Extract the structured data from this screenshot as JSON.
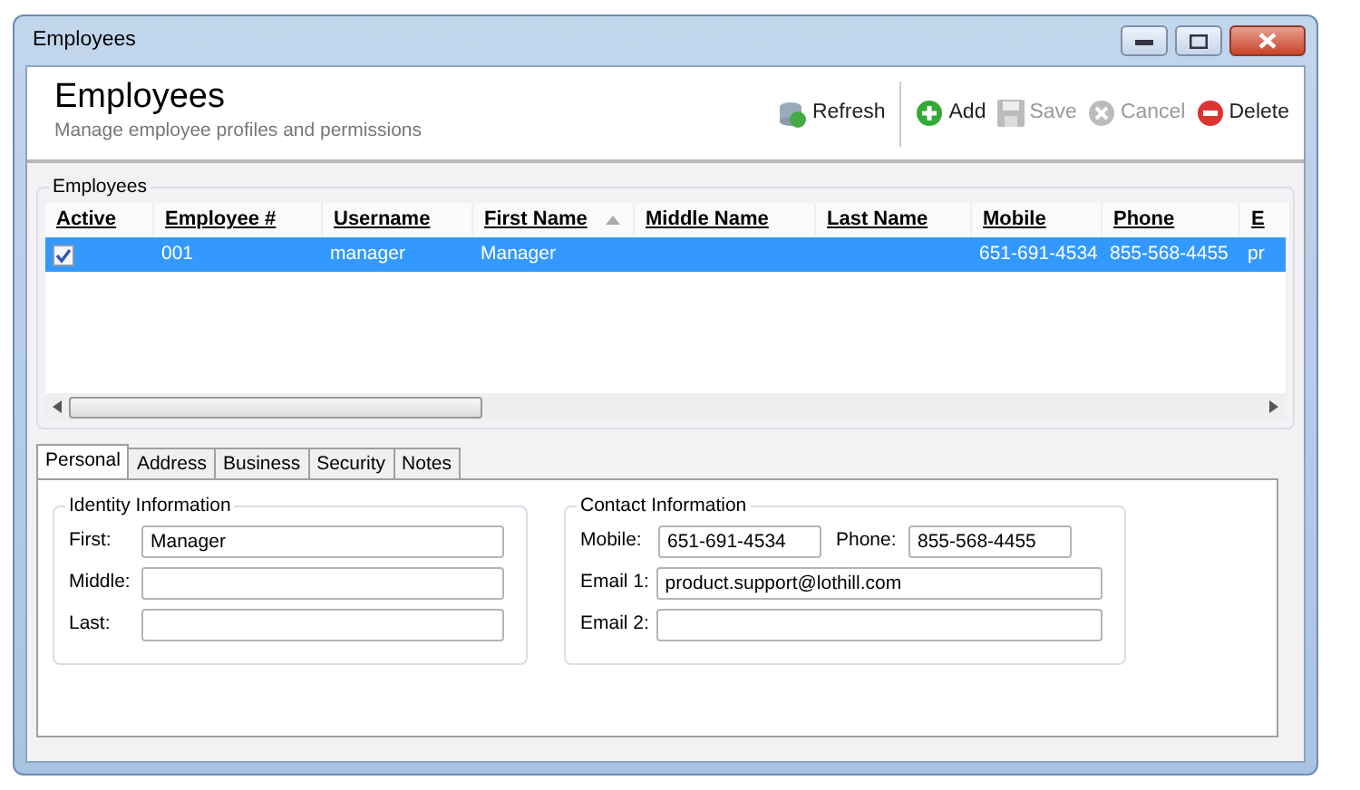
{
  "window": {
    "title": "Employees"
  },
  "header": {
    "title": "Employees",
    "subtitle": "Manage employee profiles and permissions"
  },
  "toolbar": [
    {
      "kind": "refresh",
      "label": "Refresh",
      "disabled": false
    },
    {
      "kind": "add",
      "label": "Add",
      "disabled": false
    },
    {
      "kind": "save",
      "label": "Save",
      "disabled": true
    },
    {
      "kind": "cancel",
      "label": "Cancel",
      "disabled": true
    },
    {
      "kind": "delete",
      "label": "Delete",
      "disabled": false
    }
  ],
  "grid": {
    "title": "Employees",
    "columns": [
      {
        "label": "Active",
        "sorted": false
      },
      {
        "label": "Employee #",
        "sorted": false
      },
      {
        "label": "Username",
        "sorted": false
      },
      {
        "label": "First Name",
        "sorted": true
      },
      {
        "label": "Middle Name",
        "sorted": false
      },
      {
        "label": "Last Name",
        "sorted": false
      },
      {
        "label": "Mobile",
        "sorted": false
      },
      {
        "label": "Phone",
        "sorted": false
      },
      {
        "label": "E",
        "sorted": false
      }
    ],
    "rows": [
      {
        "selected": true,
        "cells": [
          {
            "kind": "checkbox",
            "checked": true
          },
          {
            "kind": "text",
            "text": "001"
          },
          {
            "kind": "text",
            "text": "manager"
          },
          {
            "kind": "text",
            "text": "Manager"
          },
          {
            "kind": "text"
          },
          {
            "kind": "text"
          },
          {
            "kind": "text",
            "text": "651-691-4534"
          },
          {
            "kind": "text",
            "text": "855-568-4455"
          },
          {
            "kind": "text",
            "text": "pr"
          }
        ]
      }
    ]
  },
  "tabs": [
    {
      "label": "Personal",
      "selected": true
    },
    {
      "label": "Address",
      "selected": false
    },
    {
      "label": "Business",
      "selected": false
    },
    {
      "label": "Security",
      "selected": false
    },
    {
      "label": "Notes",
      "selected": false
    }
  ],
  "identity": {
    "title": "Identity Information",
    "fields": [
      {
        "label": "First:",
        "value": "Manager"
      },
      {
        "label": "Middle:"
      },
      {
        "label": "Last:"
      }
    ]
  },
  "contact": {
    "title": "Contact Information",
    "mobile": {
      "label": "Mobile:",
      "value": "651-691-4534"
    },
    "phone": {
      "label": "Phone:",
      "value": "855-568-4455"
    },
    "emails": [
      {
        "label": "Email 1:",
        "value": "product.support@lothill.com"
      },
      {
        "label": "Email 2:"
      }
    ]
  }
}
